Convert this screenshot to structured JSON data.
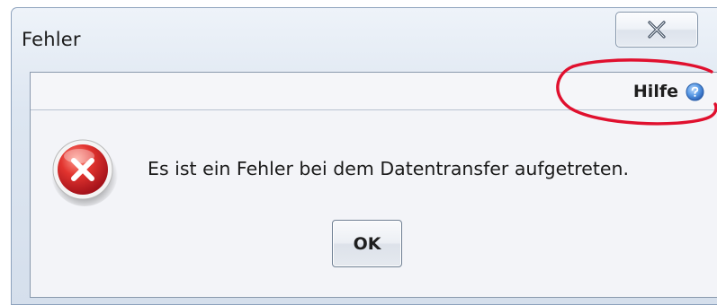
{
  "window": {
    "title": "Fehler",
    "close_icon": "close-icon"
  },
  "help": {
    "label": "Hilfe",
    "icon": "help-question-icon",
    "annotation_color": "#e0102e"
  },
  "message": {
    "icon": "error-icon",
    "text": "Es ist ein Fehler bei dem Datentransfer aufgetreten."
  },
  "buttons": {
    "ok_label": "OK"
  },
  "colors": {
    "error_red": "#d9262b",
    "help_blue": "#3b7fd4"
  }
}
